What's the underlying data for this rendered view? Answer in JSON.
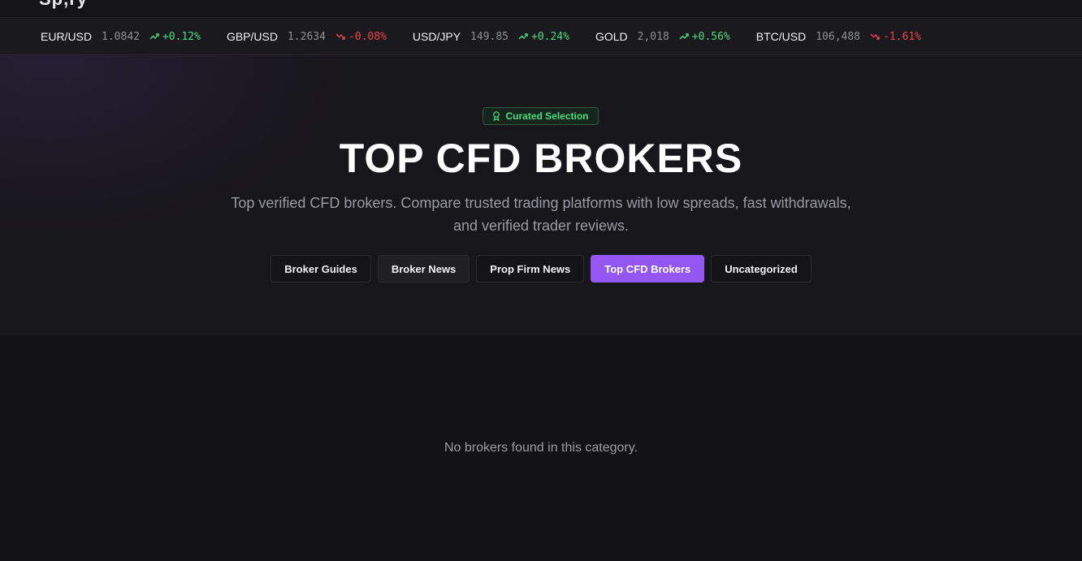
{
  "header": {
    "logo_sliver": "Sp,ry"
  },
  "ticker": [
    {
      "symbol": "EUR/USD",
      "price": "1.0842",
      "change": "+0.12%",
      "direction": "up"
    },
    {
      "symbol": "GBP/USD",
      "price": "1.2634",
      "change": "-0.08%",
      "direction": "down"
    },
    {
      "symbol": "USD/JPY",
      "price": "149.85",
      "change": "+0.24%",
      "direction": "up"
    },
    {
      "symbol": "GOLD",
      "price": "2,018",
      "change": "+0.56%",
      "direction": "up"
    },
    {
      "symbol": "BTC/USD",
      "price": "106,488",
      "change": "-1.61%",
      "direction": "down"
    }
  ],
  "hero": {
    "badge": "Curated Selection",
    "badge_icon": "award-icon",
    "title": "TOP CFD BROKERS",
    "subtitle": "Top verified CFD brokers. Compare trusted trading platforms with low spreads, fast withdrawals, and verified trader reviews."
  },
  "categories": [
    {
      "label": "Broker Guides",
      "state": "default"
    },
    {
      "label": "Broker News",
      "state": "hover"
    },
    {
      "label": "Prop Firm News",
      "state": "default"
    },
    {
      "label": "Top CFD Brokers",
      "state": "active"
    },
    {
      "label": "Uncategorized",
      "state": "default"
    }
  ],
  "content": {
    "empty_message": "No brokers found in this category."
  },
  "colors": {
    "accent": "#9356f0",
    "up": "#4ade80",
    "down": "#ef4444",
    "background": "#131317"
  }
}
